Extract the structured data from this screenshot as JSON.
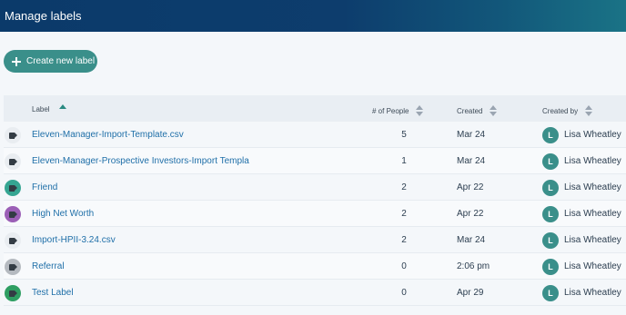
{
  "header": {
    "title": "Manage labels"
  },
  "toolbar": {
    "create_label": "Create new label"
  },
  "table": {
    "columns": {
      "label": "Label",
      "people": "# of People",
      "created": "Created",
      "created_by": "Created by"
    },
    "rows": [
      {
        "label": "Eleven-Manager-Import-Template.csv",
        "people": "5",
        "created": "Mar 24",
        "avatar": "L",
        "created_by": "Lisa Wheatley",
        "tag_color": "#e9edf1"
      },
      {
        "label": "Eleven-Manager-Prospective Investors-Import Templa",
        "people": "1",
        "created": "Mar 24",
        "avatar": "L",
        "created_by": "Lisa Wheatley",
        "tag_color": "#e9edf1"
      },
      {
        "label": "Friend",
        "people": "2",
        "created": "Apr 22",
        "avatar": "L",
        "created_by": "Lisa Wheatley",
        "tag_color": "#35a592"
      },
      {
        "label": "High Net Worth",
        "people": "2",
        "created": "Apr 22",
        "avatar": "L",
        "created_by": "Lisa Wheatley",
        "tag_color": "#9b5fb6"
      },
      {
        "label": "Import-HPII-3.24.csv",
        "people": "2",
        "created": "Mar 24",
        "avatar": "L",
        "created_by": "Lisa Wheatley",
        "tag_color": "#e9edf1"
      },
      {
        "label": "Referral",
        "people": "0",
        "created": "2:06 pm",
        "avatar": "L",
        "created_by": "Lisa Wheatley",
        "tag_color": "#b5bac0"
      },
      {
        "label": "Test Label",
        "people": "0",
        "created": "Apr 29",
        "avatar": "L",
        "created_by": "Lisa Wheatley",
        "tag_color": "#2e9e62"
      }
    ]
  },
  "icons": {
    "create_button": "plus-icon",
    "row_tag": "tag-icon",
    "sort": "sort-icon"
  },
  "colors": {
    "header_bg": "#0d3d6d",
    "accent": "#3a8f8a",
    "link": "#1f6fa8"
  }
}
